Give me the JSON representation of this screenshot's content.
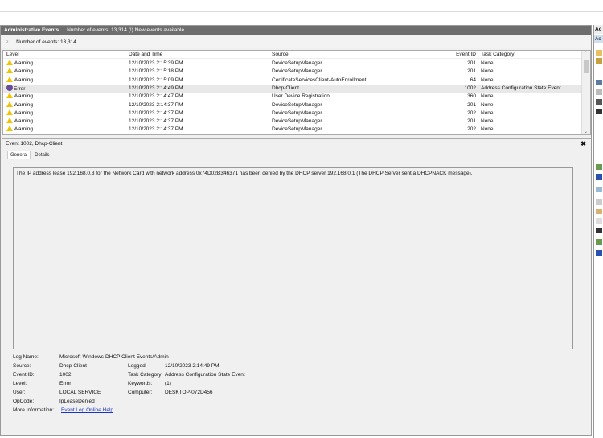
{
  "titlebar": {
    "title": "Administrative Events",
    "info": "Number of events: 13,314 (!) New events available"
  },
  "filterbar": {
    "text": "Number of events: 13,314"
  },
  "grid": {
    "headers": [
      "Level",
      "Date and Time",
      "Source",
      "Event ID",
      "Task Category"
    ],
    "rows": [
      {
        "level": "Warning",
        "icon": "warning-icon",
        "date": "12/10/2023 2:15:39 PM",
        "source": "DeviceSetupManager",
        "id": "201",
        "cat": "None"
      },
      {
        "level": "Warning",
        "icon": "warning-icon",
        "date": "12/10/2023 2:15:18 PM",
        "source": "DeviceSetupManager",
        "id": "201",
        "cat": "None"
      },
      {
        "level": "Warning",
        "icon": "warning-icon",
        "date": "12/10/2023 2:15:09 PM",
        "source": "CertificateServicesClient-AutoEnrollment",
        "id": "64",
        "cat": "None"
      },
      {
        "level": "Error",
        "icon": "error-icon",
        "date": "12/10/2023 2:14:49 PM",
        "source": "Dhcp-Client",
        "id": "1002",
        "cat": "Address Configuration State Event",
        "selected": true
      },
      {
        "level": "Warning",
        "icon": "warning-icon",
        "date": "12/10/2023 2:14:47 PM",
        "source": "User Device Registration",
        "id": "360",
        "cat": "None"
      },
      {
        "level": "Warning",
        "icon": "warning-icon",
        "date": "12/10/2023 2:14:37 PM",
        "source": "DeviceSetupManager",
        "id": "201",
        "cat": "None"
      },
      {
        "level": "Warning",
        "icon": "warning-icon",
        "date": "12/10/2023 2:14:37 PM",
        "source": "DeviceSetupManager",
        "id": "202",
        "cat": "None"
      },
      {
        "level": "Warning",
        "icon": "warning-icon",
        "date": "12/10/2023 2:14:37 PM",
        "source": "DeviceSetupManager",
        "id": "201",
        "cat": "None"
      },
      {
        "level": "Warning",
        "icon": "warning-icon",
        "date": "12/10/2023 2:14:37 PM",
        "source": "DeviceSetupManager",
        "id": "202",
        "cat": "None"
      }
    ]
  },
  "detail": {
    "title": "Event 1002, Dhcp-Client",
    "tabs": [
      "General",
      "Details"
    ],
    "message": "The IP address lease 192.168.0.3 for the Network Card with network address 0x74D02B346371 has been denied by the DHCP server 192.168.0.1 (The DHCP Server sent a DHCPNACK message).",
    "fields": {
      "log_name_label": "Log Name:",
      "log_name": "Microsoft-Windows-DHCP Client Events/Admin",
      "source_label": "Source:",
      "source": "Dhcp-Client",
      "logged_label": "Logged:",
      "logged": "12/10/2023 2:14:49 PM",
      "event_id_label": "Event ID:",
      "event_id": "1002",
      "task_label": "Task Category:",
      "task": "Address Configuration State Event",
      "level_label": "Level:",
      "level": "Error",
      "keywords_label": "Keywords:",
      "keywords": "(1)",
      "user_label": "User:",
      "user": "LOCAL SERVICE",
      "computer_label": "Computer:",
      "computer": "DESKTOP-072D456",
      "opcode_label": "OpCode:",
      "opcode": "IpLeaseDenied",
      "more_label": "More Information:",
      "more_link": "Event Log Online Help"
    }
  },
  "actions": {
    "header": "Ac",
    "subheader": "Ac"
  }
}
